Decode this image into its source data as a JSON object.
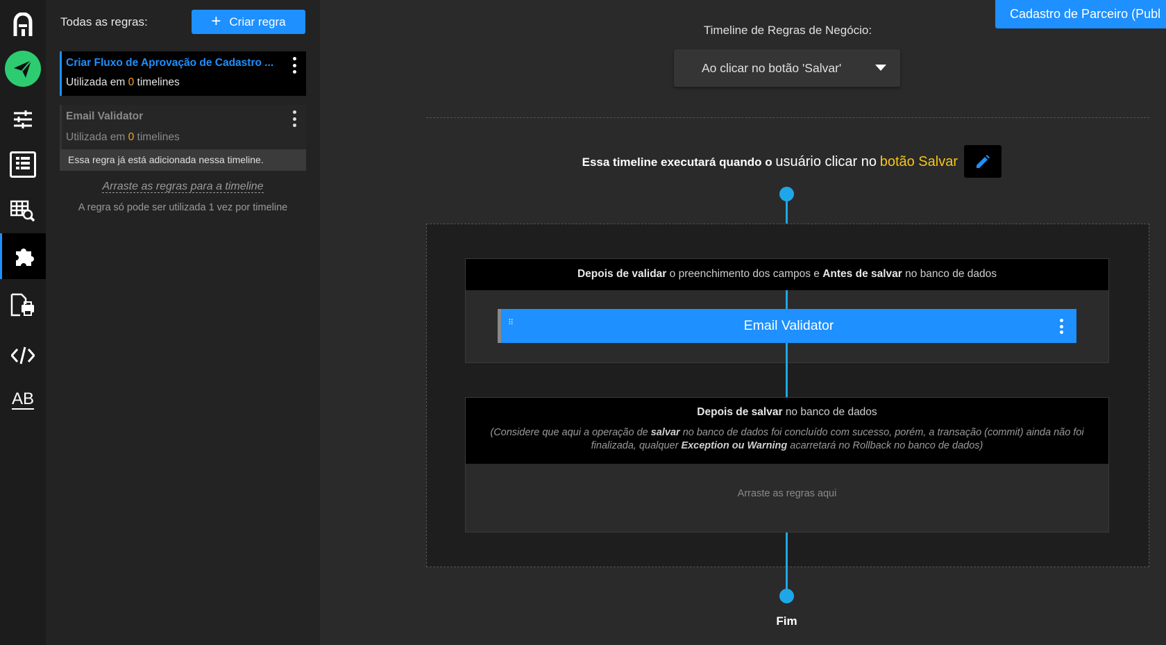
{
  "rail": {
    "items": [
      {
        "name": "app-logo",
        "icon": "logo-icon"
      },
      {
        "name": "publish",
        "icon": "paper-plane-icon"
      },
      {
        "name": "settings",
        "icon": "sliders-icon"
      },
      {
        "name": "form",
        "icon": "form-list-icon"
      },
      {
        "name": "table-search",
        "icon": "table-search-icon"
      },
      {
        "name": "rules",
        "icon": "puzzle-icon",
        "active": true
      },
      {
        "name": "print",
        "icon": "document-print-icon"
      },
      {
        "name": "code",
        "icon": "code-icon"
      },
      {
        "name": "translations",
        "icon": "ab-icon",
        "text": "AB"
      }
    ]
  },
  "panel": {
    "title": "Todas as regras:",
    "create_label": "Criar regra",
    "create_icon": "+",
    "rules": [
      {
        "name": "Criar Fluxo de Aprovação de Cadastro ...",
        "usage_prefix": "Utilizada em",
        "usage_count": "0",
        "usage_suffix": "timelines"
      },
      {
        "name": "Email Validator",
        "usage_prefix": "Utilizada em",
        "usage_count": "0",
        "usage_suffix": "timelines",
        "note": "Essa regra já está adicionada nessa timeline."
      }
    ],
    "drag_hint": "Arraste as regras para a timeline",
    "once_hint": "A regra só pode ser utilizada 1 vez por timeline"
  },
  "header": {
    "top_right_button": "Cadastro de Parceiro (Publ",
    "timeline_label": "Timeline de Regras de Negócio:",
    "timeline_select": "Ao clicar no botão 'Salvar'"
  },
  "exec": {
    "prefix": "Essa timeline executará quando o",
    "mid": "usuário clicar no",
    "highlight": "botão Salvar"
  },
  "sections": {
    "before_save": {
      "b1": "Depois de validar",
      "t1": "o preenchimento dos campos e",
      "b2": "Antes de salvar",
      "t2": "no banco de dados",
      "chip_label": "Email Validator"
    },
    "after_save": {
      "b1": "Depois de salvar",
      "t1": "no banco de dados",
      "sub_a": "(Considere que aqui a operação de",
      "sub_b": "salvar",
      "sub_c": "no banco de dados foi concluído com sucesso, porém, a transação (commit) ainda não foi finalizada, qualquer",
      "sub_d": "Exception ou Warning",
      "sub_e": "acarretará no Rollback no banco de dados)",
      "drop_hint": "Arraste as regras aqui"
    }
  },
  "end_label": "Fim",
  "colors": {
    "accent": "#1e90ff",
    "timeline": "#1ea7e8",
    "highlight": "#f5c518",
    "count": "#f5a623",
    "publish_green": "#2ecc71"
  }
}
